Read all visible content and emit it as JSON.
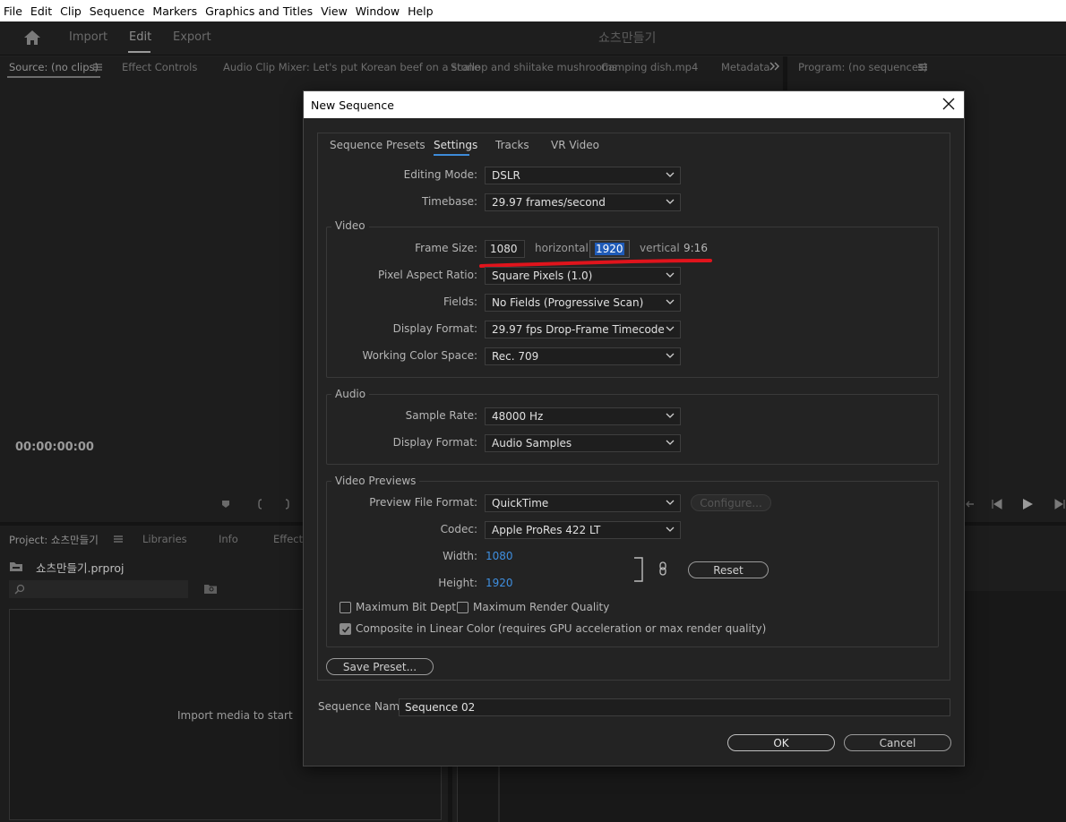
{
  "menu": [
    "File",
    "Edit",
    "Clip",
    "Sequence",
    "Markers",
    "Graphics and Titles",
    "View",
    "Window",
    "Help"
  ],
  "header": {
    "tabs": [
      "Import",
      "Edit",
      "Export"
    ],
    "active_tab": "Edit",
    "project_title": "쇼츠만들기"
  },
  "source_panel": {
    "tabs": [
      "Source: (no clips)",
      "Effect Controls",
      "Audio Clip Mixer: Let's put Korean beef on a stone",
      "Scallop and shiitake mushrooms",
      "Camping dish.mp4",
      "Metadata"
    ],
    "timecode": "00:00:00:00"
  },
  "program_panel": {
    "tab": "Program: (no sequences)"
  },
  "project_panel": {
    "tabs": [
      "Project: 쇼츠만들기",
      "Libraries",
      "Info",
      "Effects"
    ],
    "file_name": "쇼츠만들기.prproj",
    "empty_message": "Import media to start"
  },
  "dialog": {
    "title": "New Sequence",
    "tabs": [
      "Sequence Presets",
      "Settings",
      "Tracks",
      "VR Video"
    ],
    "active_tab": "Settings",
    "editing_mode": {
      "label": "Editing Mode:",
      "value": "DSLR"
    },
    "timebase": {
      "label": "Timebase:",
      "value": "29.97  frames/second"
    },
    "video": {
      "title": "Video",
      "frame_size": {
        "label": "Frame Size:",
        "width": "1080",
        "width_label": "horizontal",
        "height": "1920",
        "height_label": "vertical",
        "ratio": "9:16"
      },
      "pixel_aspect_ratio": {
        "label": "Pixel Aspect Ratio:",
        "value": "Square Pixels (1.0)"
      },
      "fields": {
        "label": "Fields:",
        "value": "No Fields (Progressive Scan)"
      },
      "display_format": {
        "label": "Display Format:",
        "value": "29.97 fps Drop-Frame Timecode"
      },
      "working_color_space": {
        "label": "Working Color Space:",
        "value": "Rec. 709"
      }
    },
    "audio": {
      "title": "Audio",
      "sample_rate": {
        "label": "Sample Rate:",
        "value": "48000 Hz"
      },
      "display_format": {
        "label": "Display Format:",
        "value": "Audio Samples"
      }
    },
    "video_previews": {
      "title": "Video Previews",
      "preview_file_format": {
        "label": "Preview File Format:",
        "value": "QuickTime"
      },
      "configure_label": "Configure...",
      "codec": {
        "label": "Codec:",
        "value": "Apple ProRes 422 LT"
      },
      "width": {
        "label": "Width:",
        "value": "1080"
      },
      "height": {
        "label": "Height:",
        "value": "1920"
      },
      "reset_label": "Reset"
    },
    "options": {
      "max_bit_depth": {
        "label": "Maximum Bit Depth",
        "checked": false
      },
      "max_render_quality": {
        "label": "Maximum Render Quality",
        "checked": false
      },
      "composite_linear": {
        "label": "Composite in Linear Color (requires GPU acceleration or max render quality)",
        "checked": true
      }
    },
    "save_preset_label": "Save Preset...",
    "sequence_name": {
      "label": "Sequence Name:",
      "value": "Sequence 02"
    },
    "ok_label": "OK",
    "cancel_label": "Cancel",
    "annotation_color": "#e0141c"
  }
}
